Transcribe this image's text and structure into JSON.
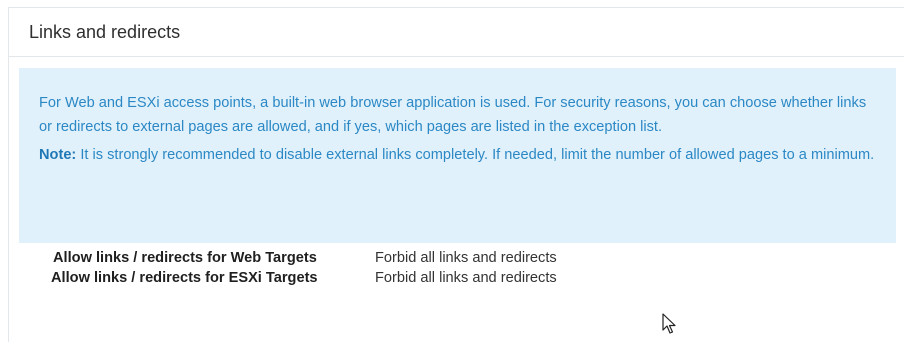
{
  "section": {
    "title": "Links and redirects"
  },
  "info": {
    "text": "For Web and ESXi access points, a built-in web browser application is used. For security reasons, you can choose whether links or redirects to external pages are allowed, and if yes, which pages are listed in the exception list.",
    "note_label": "Note:",
    "note_text": " It is strongly recommended to disable external links completely. If needed, limit the number of allowed pages to a minimum."
  },
  "settings": [
    {
      "label": "Allow links / redirects for Web Targets",
      "value": "Forbid all links and redirects"
    },
    {
      "label": "Allow links / redirects for ESXi Targets",
      "value": "Forbid all links and redirects"
    }
  ],
  "icons": {
    "cursor": "mouse-pointer-icon"
  }
}
